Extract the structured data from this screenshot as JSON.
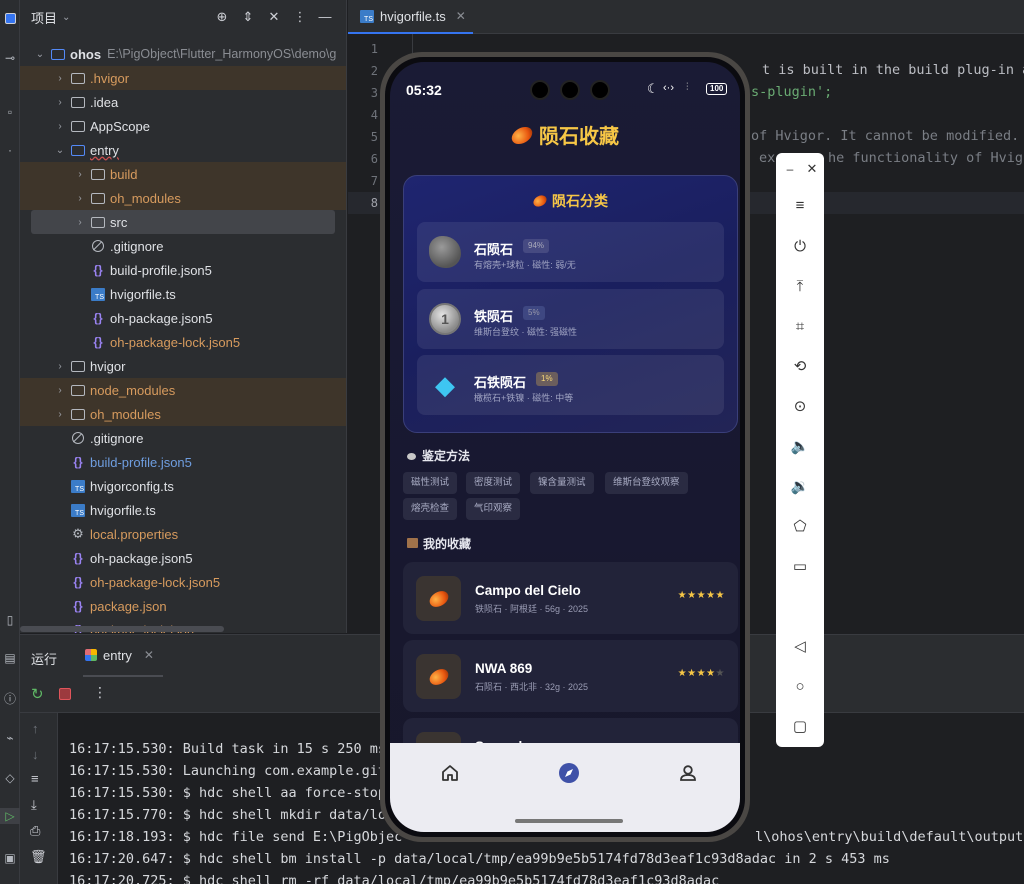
{
  "project_panel": {
    "title": "项目",
    "root_name": "ohos",
    "root_path": "E:\\PigObject\\Flutter_HarmonyOS\\demo\\g",
    "items": [
      {
        "label": ".hvigor",
        "type": "folder",
        "depth": 1,
        "color": "orange",
        "expanded": false,
        "highlight": true
      },
      {
        "label": ".idea",
        "type": "folder",
        "depth": 1,
        "color": "white",
        "expanded": false
      },
      {
        "label": "AppScope",
        "type": "folder",
        "depth": 1,
        "color": "white",
        "expanded": false
      },
      {
        "label": "entry",
        "type": "module",
        "depth": 1,
        "color": "white",
        "expanded": true
      },
      {
        "label": "build",
        "type": "folder",
        "depth": 2,
        "color": "orange",
        "expanded": false,
        "highlight": true
      },
      {
        "label": "oh_modules",
        "type": "folder",
        "depth": 2,
        "color": "orange",
        "expanded": false,
        "highlight": true
      },
      {
        "label": "src",
        "type": "folder",
        "depth": 2,
        "color": "white",
        "expanded": false,
        "selected": true
      },
      {
        "label": ".gitignore",
        "type": "ignore",
        "depth": 2,
        "color": "white"
      },
      {
        "label": "build-profile.json5",
        "type": "json",
        "depth": 2,
        "color": "white"
      },
      {
        "label": "hvigorfile.ts",
        "type": "ts",
        "depth": 2,
        "color": "white"
      },
      {
        "label": "oh-package.json5",
        "type": "json",
        "depth": 2,
        "color": "white"
      },
      {
        "label": "oh-package-lock.json5",
        "type": "json",
        "depth": 2,
        "color": "orange"
      },
      {
        "label": "hvigor",
        "type": "folder",
        "depth": 1,
        "color": "white",
        "expanded": false
      },
      {
        "label": "node_modules",
        "type": "folder",
        "depth": 1,
        "color": "orange",
        "expanded": false,
        "highlight": true
      },
      {
        "label": "oh_modules",
        "type": "folder",
        "depth": 1,
        "color": "orange",
        "expanded": false,
        "highlight": true
      },
      {
        "label": ".gitignore",
        "type": "ignore",
        "depth": 1,
        "color": "white"
      },
      {
        "label": "build-profile.json5",
        "type": "json",
        "depth": 1,
        "color": "blue"
      },
      {
        "label": "hvigorconfig.ts",
        "type": "ts",
        "depth": 1,
        "color": "white"
      },
      {
        "label": "hvigorfile.ts",
        "type": "ts",
        "depth": 1,
        "color": "white"
      },
      {
        "label": "local.properties",
        "type": "gear",
        "depth": 1,
        "color": "orange"
      },
      {
        "label": "oh-package.json5",
        "type": "json",
        "depth": 1,
        "color": "white"
      },
      {
        "label": "oh-package-lock.json5",
        "type": "json",
        "depth": 1,
        "color": "orange"
      },
      {
        "label": "package.json",
        "type": "json",
        "depth": 1,
        "color": "orange"
      },
      {
        "label": "package-lock.json",
        "type": "json",
        "depth": 1,
        "color": "orange"
      }
    ]
  },
  "editor": {
    "tab_label": "hvigorfile.ts",
    "line_numbers": [
      "1",
      "2",
      "3",
      "4",
      "5",
      "6",
      "7",
      "8"
    ],
    "code_fragments": {
      "line2": "t is built in the build plug-in and",
      "line3": "s-plugin';",
      "line5": "of Hvigor. It cannot be modified.",
      "line6a": "ex",
      "line6b": "he functionality of Hvigor"
    }
  },
  "run_panel": {
    "tab_run": "运行",
    "tab_entry": "entry",
    "log_lines": [
      "16:17:15.530: Build task in 15 s 250 ms",
      "16:17:15.530: Launching com.example.git",
      "16:17:15.530: $ hdc shell aa force-stop",
      "16:17:15.770: $ hdc shell mkdir data/lo",
      "16:17:18.193: $ hdc file send E:\\PigObjec",
      "16:17:20.647: $ hdc shell bm install -p data/local/tmp/ea99b9e5b5174fd78d3eaf1c93d8adac in 2 s 453 ms",
      "16:17:20.725: $ hdc shell rm -rf data/local/tmp/ea99b9e5b5174fd78d3eaf1c93d8adac"
    ],
    "log_tail_18": "l\\ohos\\entry\\build\\default\\outputs\\d"
  },
  "phone": {
    "status": {
      "time": "05:32",
      "battery": "100"
    },
    "app_title": "陨石收藏",
    "category_section": {
      "title": "陨石分类",
      "items": [
        {
          "name": "石陨石",
          "badge": "94%",
          "desc": "有熔壳+球粒 · 磁性: 弱/无",
          "icon": "rock-icon"
        },
        {
          "name": "铁陨石",
          "badge": "5%",
          "desc": "维斯台登纹 · 磁性: 强磁性",
          "icon": "coin-icon"
        },
        {
          "name": "石铁陨石",
          "badge": "1%",
          "desc": "橄榄石+铁镍 · 磁性: 中等",
          "icon": "diamond-icon"
        }
      ]
    },
    "identify_section": {
      "title": "鉴定方法",
      "chips": [
        "磁性测试",
        "密度测试",
        "镍含量测试",
        "维斯台登纹观察",
        "熔壳检查",
        "气印观察"
      ]
    },
    "collection_section": {
      "title": "我的收藏",
      "items": [
        {
          "name": "Campo del Cielo",
          "meta": "铁陨石 · 阿根廷 · 56g · 2025",
          "stars": "★★★★★"
        },
        {
          "name": "NWA 869",
          "meta": "石陨石 · 西北非 · 32g · 2025",
          "stars": "★★★★",
          "empty_stars": "★"
        },
        {
          "name": "Seymchan",
          "meta": "",
          "stars": "★★★★★"
        }
      ]
    },
    "colors": {
      "accent": "#f7c746",
      "card_bg": "#222339",
      "category_bg": "#1f2570"
    }
  }
}
